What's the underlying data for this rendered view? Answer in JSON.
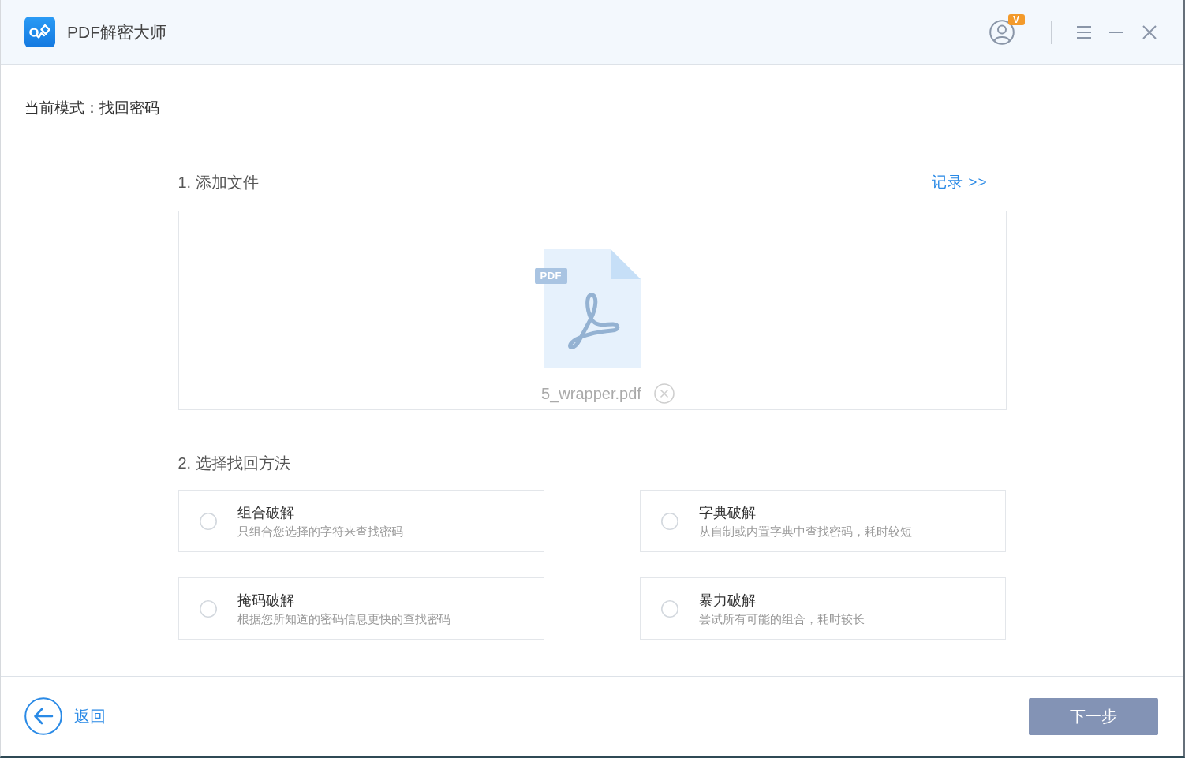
{
  "window": {
    "title": "PDF解密大师",
    "badge": "V"
  },
  "mode": "当前模式：找回密码",
  "add_file": {
    "title": "1. 添加文件",
    "link": "记录 >>",
    "file_tag": "PDF",
    "file_name": "5_wrapper.pdf"
  },
  "recovery_method": {
    "title": "2. 选择找回方法",
    "options": [
      {
        "title": "组合破解",
        "description": "只组合您选择的字符来查找密码",
        "selected": false
      },
      {
        "title": "字典破解",
        "description": "从自制或内置字典中查找密码，耗时较短",
        "selected": false
      },
      {
        "title": "掩码破解",
        "description": "根据您所知道的密码信息更快的查找密码",
        "selected": false
      },
      {
        "title": "暴力破解",
        "description": "尝试所有可能的组合，耗时较长",
        "selected": false
      }
    ]
  },
  "footer": {
    "back": "返回",
    "next": {
      "label": "下一步",
      "disabled": true
    }
  }
}
